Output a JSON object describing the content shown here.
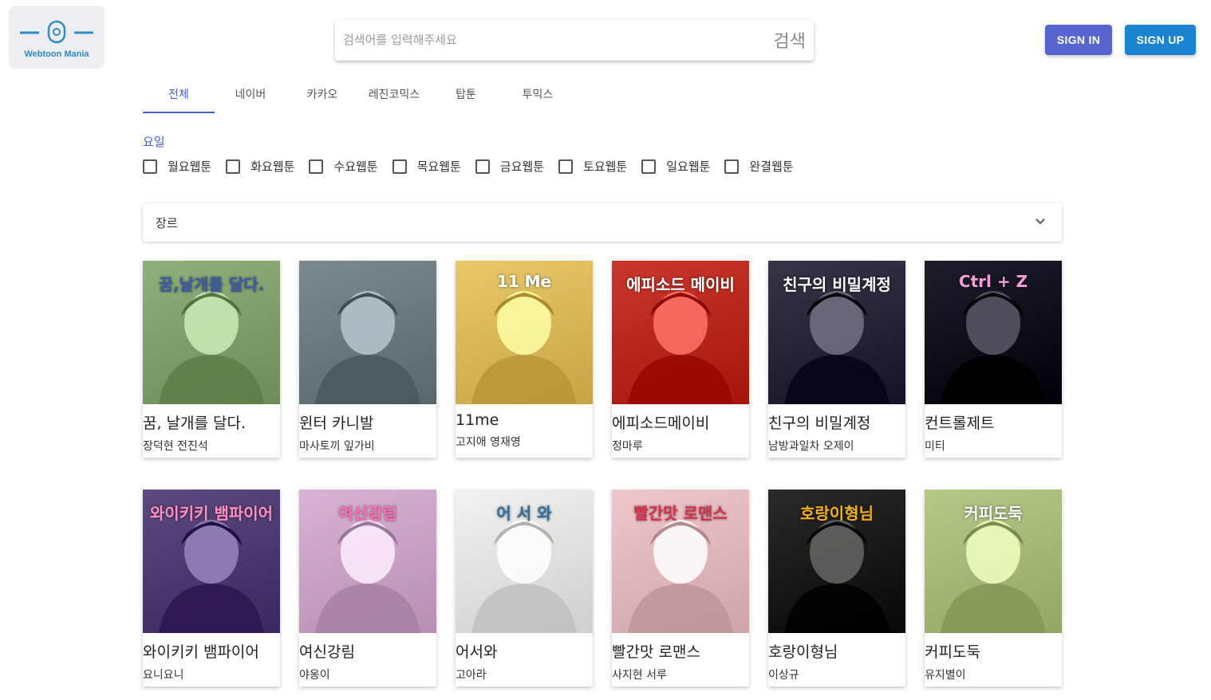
{
  "logo": {
    "text": "Webtoon Mania"
  },
  "search": {
    "placeholder": "검색어를 입력해주세요",
    "button_label": "검색"
  },
  "auth": {
    "signin_label": "SIGN IN",
    "signup_label": "SIGN UP"
  },
  "tabs": [
    {
      "label": "전체",
      "active": true
    },
    {
      "label": "네이버"
    },
    {
      "label": "카카오"
    },
    {
      "label": "레진코믹스"
    },
    {
      "label": "탑툰"
    },
    {
      "label": "투믹스"
    }
  ],
  "filters": {
    "day_label": "요일",
    "days": [
      "월요웹툰",
      "화요웹툰",
      "수요웹툰",
      "목요웹툰",
      "금요웹툰",
      "토요웹툰",
      "일요웹툰",
      "완결웹툰"
    ],
    "genre_label": "장르"
  },
  "colors": {
    "accent": "#4a5fc8",
    "signin": "#5865d0",
    "signup": "#1a84d0",
    "logo_blue": "#2f8cc4"
  },
  "webtoons": [
    {
      "title": "꿈, 날개를 달다.",
      "author": "장덕현 전진석",
      "cover_text": "꿈,날개를 달다.",
      "bg": "#8fb07a",
      "fg": "#3b5aa8"
    },
    {
      "title": "윈터 카니발",
      "author": "마사토끼 잎가비",
      "cover_text": "",
      "bg": "#7c8a90",
      "fg": "#1d2533"
    },
    {
      "title": "11me",
      "author": "고지애 영재영",
      "cover_text": "11 Me",
      "bg": "#e9c86a",
      "fg": "#ffffff"
    },
    {
      "title": "에피소드메이비",
      "author": "정마루",
      "cover_text": "에피소드 메이비",
      "bg": "#c9382c",
      "fg": "#ffffff"
    },
    {
      "title": "친구의 비밀계정",
      "author": "남방과일차 오제이",
      "cover_text": "친구의 비밀계정",
      "bg": "#3a3448",
      "fg": "#ffffff"
    },
    {
      "title": "컨트롤제트",
      "author": "미티",
      "cover_text": "Ctrl + Z",
      "bg": "#1f1d2b",
      "fg": "#f0a0d8"
    },
    {
      "title": "와이키키 뱀파이어",
      "author": "요니요니",
      "cover_text": "와이키키 뱀파이어",
      "bg": "#5d4a80",
      "fg": "#ff8fc0"
    },
    {
      "title": "여신강림",
      "author": "야옹이",
      "cover_text": "여신강림",
      "bg": "#d9b2d6",
      "fg": "#ff6fb0"
    },
    {
      "title": "어서와",
      "author": "고아라",
      "cover_text": "어 서 와",
      "bg": "#f2f2f0",
      "fg": "#2f6fa0"
    },
    {
      "title": "빨간맛 로맨스",
      "author": "사지현 서루",
      "cover_text": "빨간맛 로맨스",
      "bg": "#f1c7cc",
      "fg": "#d8304a"
    },
    {
      "title": "호랑이형님",
      "author": "이상규",
      "cover_text": "호랑이형님",
      "bg": "#2b2a28",
      "fg": "#f0b020"
    },
    {
      "title": "커피도둑",
      "author": "유지별이",
      "cover_text": "커피도둑",
      "bg": "#b6c987",
      "fg": "#ffffff"
    }
  ]
}
